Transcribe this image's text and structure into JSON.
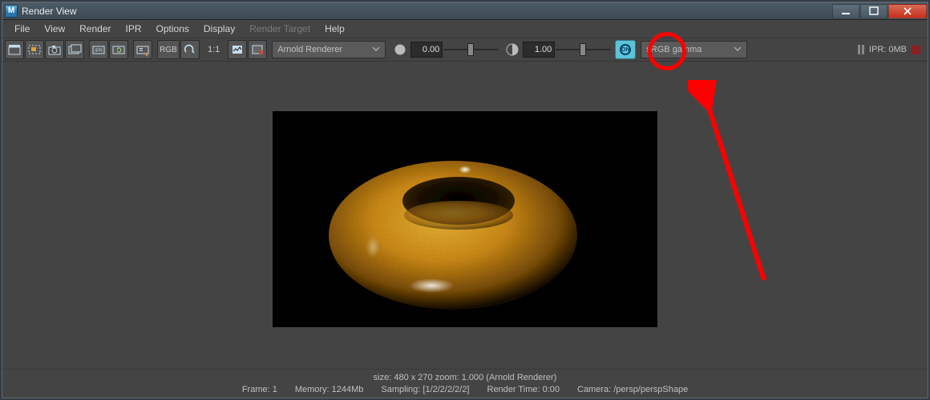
{
  "window": {
    "app_glyph": "M",
    "title": "Render View"
  },
  "menu": {
    "file": "File",
    "view": "View",
    "render": "Render",
    "ipr": "IPR",
    "options": "Options",
    "display": "Display",
    "render_target": "Render Target",
    "help": "Help"
  },
  "toolbar": {
    "rgb_label": "RGB",
    "ratio_label": "1:1",
    "renderer": "Arnold Renderer",
    "exposure_value": "0.00",
    "gamma_value": "1.00",
    "view_transform": "sRGB gamma",
    "ipr_label": "IPR: 0MB"
  },
  "status": {
    "line1": "size: 480 x 270 zoom: 1.000    (Arnold Renderer)",
    "frame": "Frame: 1",
    "memory": "Memory: 1244Mb",
    "sampling": "Sampling: [1/2/2/2/2/2]",
    "render_time": "Render Time: 0:00",
    "camera": "Camera: /persp/perspShape"
  }
}
